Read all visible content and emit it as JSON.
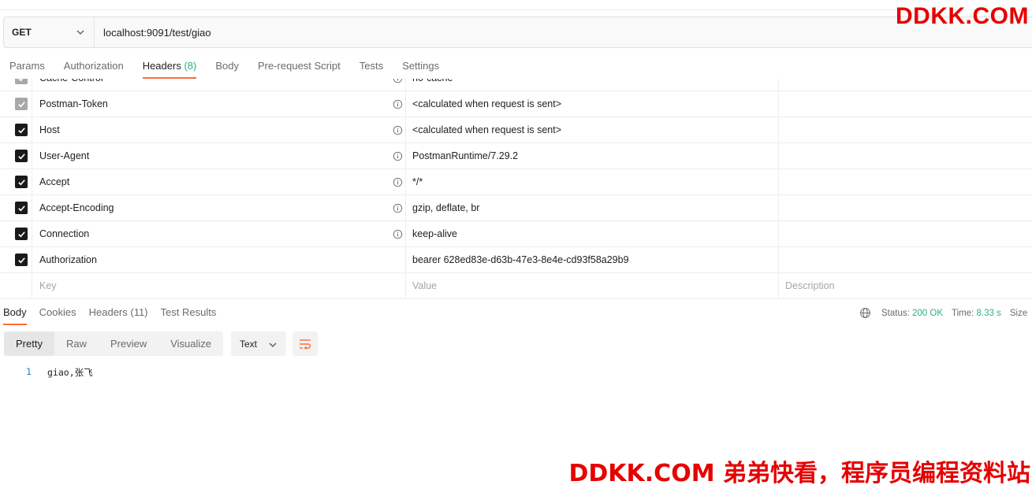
{
  "request": {
    "method": "GET",
    "url": "localhost:9091/test/giao"
  },
  "watermark": {
    "top": "DDKK.COM",
    "bottom": "DDKK.COM 弟弟快看，程序员编程资料站"
  },
  "request_tabs": [
    {
      "label": "Params"
    },
    {
      "label": "Authorization"
    },
    {
      "label": "Headers",
      "count": "(8)",
      "active": true
    },
    {
      "label": "Body"
    },
    {
      "label": "Pre-request Script"
    },
    {
      "label": "Tests"
    },
    {
      "label": "Settings"
    }
  ],
  "headers": {
    "rows": [
      {
        "key": "Cache-Control",
        "value": "no-cache",
        "checked": true,
        "disabled": true,
        "info": true
      },
      {
        "key": "Postman-Token",
        "value": "<calculated when request is sent>",
        "checked": true,
        "disabled": true,
        "info": true
      },
      {
        "key": "Host",
        "value": "<calculated when request is sent>",
        "checked": true,
        "disabled": false,
        "info": true
      },
      {
        "key": "User-Agent",
        "value": "PostmanRuntime/7.29.2",
        "checked": true,
        "disabled": false,
        "info": true
      },
      {
        "key": "Accept",
        "value": "*/*",
        "checked": true,
        "disabled": false,
        "info": true
      },
      {
        "key": "Accept-Encoding",
        "value": "gzip, deflate, br",
        "checked": true,
        "disabled": false,
        "info": true
      },
      {
        "key": "Connection",
        "value": "keep-alive",
        "checked": true,
        "disabled": false,
        "info": true
      },
      {
        "key": "Authorization",
        "value": "bearer 628ed83e-d63b-47e3-8e4e-cd93f58a29b9",
        "checked": true,
        "disabled": false,
        "info": false
      }
    ],
    "new_row": {
      "key_placeholder": "Key",
      "value_placeholder": "Value",
      "description_placeholder": "Description"
    }
  },
  "response_tabs": [
    {
      "label": "Body",
      "active": true
    },
    {
      "label": "Cookies"
    },
    {
      "label": "Headers (11)"
    },
    {
      "label": "Test Results"
    }
  ],
  "response_meta": {
    "status_label": "Status:",
    "status_value": "200 OK",
    "time_label": "Time:",
    "time_value": "8.33 s",
    "size_label": "Size"
  },
  "view_modes": [
    {
      "label": "Pretty",
      "active": true
    },
    {
      "label": "Raw"
    },
    {
      "label": "Preview"
    },
    {
      "label": "Visualize"
    }
  ],
  "format": "Text",
  "response_body": [
    {
      "line": "1",
      "text": "giao,张飞"
    }
  ],
  "colors": {
    "accent": "#ff6c37",
    "success": "#26b47f",
    "watermark": "#e60000",
    "line_number": "#2a7abf"
  },
  "icons": [
    "chevron-down-icon",
    "check-icon",
    "info-icon",
    "globe-icon",
    "wrap-lines-icon"
  ]
}
